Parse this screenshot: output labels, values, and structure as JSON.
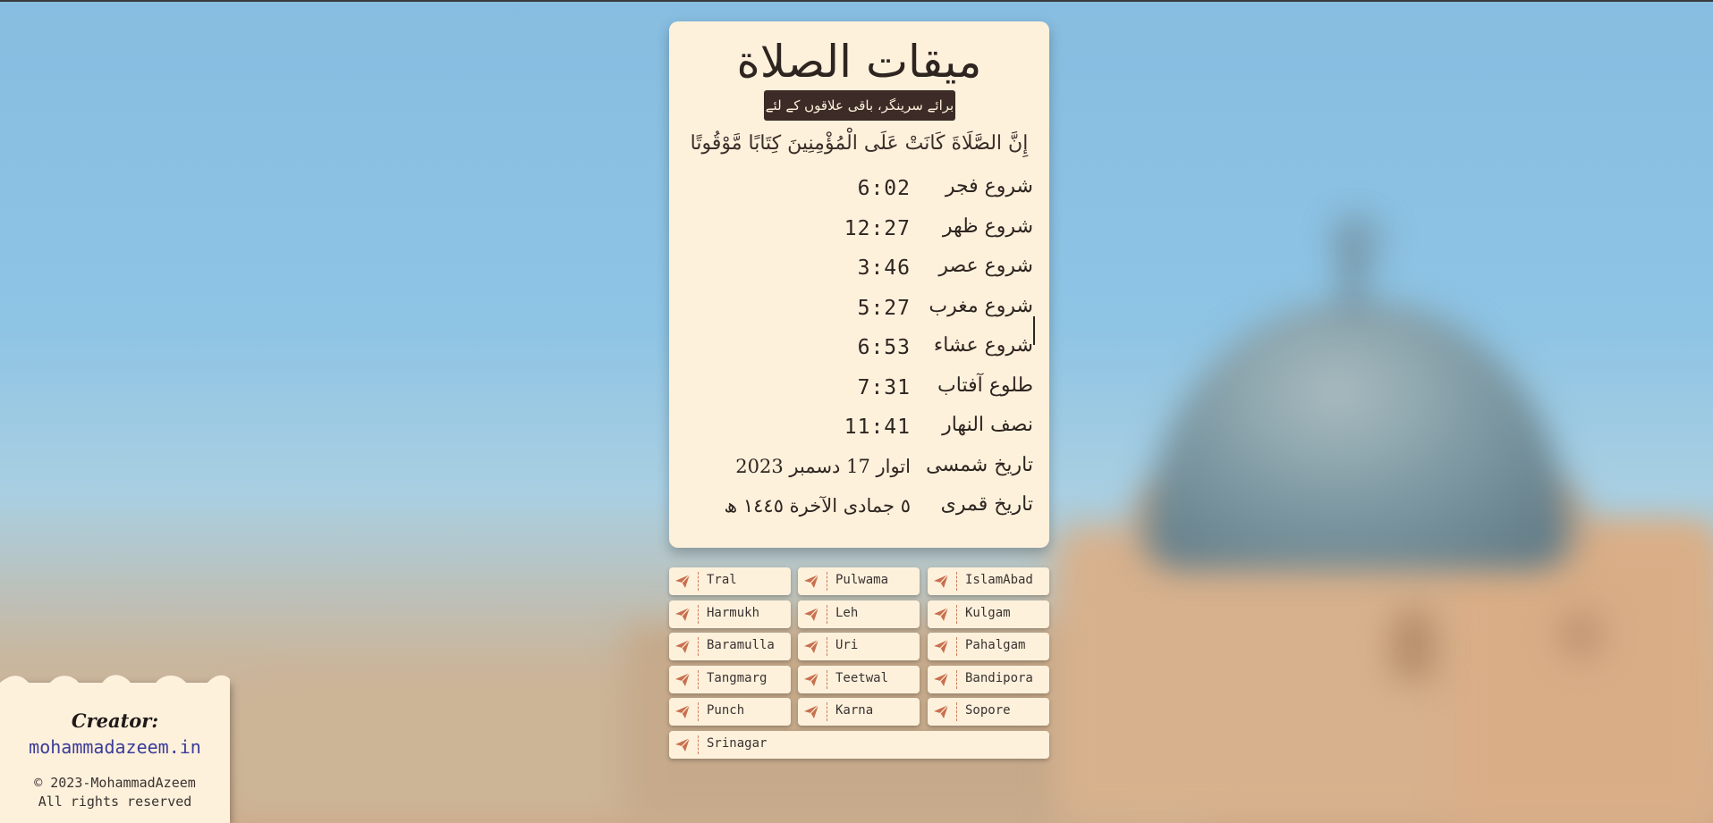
{
  "card": {
    "title": "ميقات الصلاة",
    "subtitle": "برائے سرینگر، باقی علاقوں کے لئے نیچے دیکھیں",
    "verse": "إِنَّ الصَّلَاةَ كَانَتْ عَلَى الْمُؤْمِنِينَ كِتَابًا مَّوْقُوتًا",
    "rows": [
      {
        "label": "شروع فجر",
        "value": "6:02"
      },
      {
        "label": "شروع ظهر",
        "value": "12:27"
      },
      {
        "label": "شروع عصر",
        "value": "3:46"
      },
      {
        "label": "شروع مغرب",
        "value": "5:27"
      },
      {
        "label": "شروع عشاء",
        "value": "6:53"
      },
      {
        "label": "طلوع آفتاب",
        "value": "7:31"
      },
      {
        "label": "نصف النهار",
        "value": "11:41"
      },
      {
        "label": "تاريخ شمسی",
        "value": "اتوار 17 دسمبر 2023"
      },
      {
        "label": "تاريخ قمری",
        "value": "٥ جمادى الآخرة ١٤٤٥ ھ"
      }
    ]
  },
  "cities": [
    {
      "name": "Tral"
    },
    {
      "name": "Pulwama"
    },
    {
      "name": "IslamAbad"
    },
    {
      "name": "Harmukh"
    },
    {
      "name": "Leh"
    },
    {
      "name": "Kulgam"
    },
    {
      "name": "Baramulla"
    },
    {
      "name": "Uri"
    },
    {
      "name": "Pahalgam"
    },
    {
      "name": "Tangmarg"
    },
    {
      "name": "Teetwal"
    },
    {
      "name": "Bandipora"
    },
    {
      "name": "Punch"
    },
    {
      "name": "Karna"
    },
    {
      "name": "Sopore"
    },
    {
      "name": "Srinagar"
    }
  ],
  "city_icon": "send-icon",
  "footer": {
    "creator_label": "Creator:",
    "site": "mohammadazeem.in",
    "copyright": "© 2023-MohammadAzeem",
    "rights": "All rights reserved"
  },
  "colors": {
    "card_bg": "#fdf1dc",
    "accent": "#c8704f",
    "subtitle_bg": "#3c2b26",
    "link": "#3b3b9a"
  }
}
